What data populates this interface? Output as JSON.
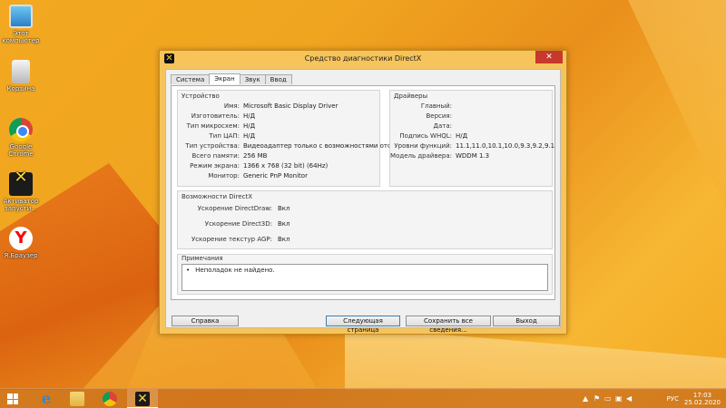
{
  "desktop": {
    "icons": [
      {
        "label": "Этот компьютер",
        "icon": "computer-icon"
      },
      {
        "label": "Корзина",
        "icon": "recycle-bin-icon"
      },
      {
        "label": "Google Chrome",
        "icon": "chrome-icon"
      },
      {
        "label": "Активатор запусти...",
        "icon": "kms-activator-icon"
      },
      {
        "label": "Я.Браузер",
        "icon": "yandex-browser-icon"
      }
    ]
  },
  "window": {
    "title": "Средство диагностики DirectX",
    "close_glyph": "✕",
    "tabs": [
      "Система",
      "Экран",
      "Звук",
      "Ввод"
    ],
    "active_tab": "Экран",
    "device": {
      "title": "Устройство",
      "rows": [
        {
          "label": "Имя:",
          "value": "Microsoft Basic Display Driver"
        },
        {
          "label": "Изготовитель:",
          "value": "Н/Д"
        },
        {
          "label": "Тип микросхем:",
          "value": "Н/Д"
        },
        {
          "label": "Тип ЦАП:",
          "value": "Н/Д"
        },
        {
          "label": "Тип устройства:",
          "value": "Видеоадаптер только с возможностями отображения"
        },
        {
          "label": "Всего памяти:",
          "value": "256 MB"
        },
        {
          "label": "Режим экрана:",
          "value": "1366 x 768 (32 bit) (64Hz)"
        },
        {
          "label": "Монитор:",
          "value": "Generic PnP Monitor"
        }
      ]
    },
    "drivers": {
      "title": "Драйверы",
      "rows": [
        {
          "label": "Главный:",
          "value": ""
        },
        {
          "label": "Версия:",
          "value": ""
        },
        {
          "label": "Дата:",
          "value": ""
        },
        {
          "label": "Подпись WHQL:",
          "value": "Н/Д"
        },
        {
          "label": "Уровни функций:",
          "value": "11.1,11.0,10.1,10.0,9.3,9.2,9.1"
        },
        {
          "label": "Модель драйвера:",
          "value": "WDDM 1.3"
        }
      ]
    },
    "directx_features": {
      "title": "Возможности DirectX",
      "rows": [
        {
          "label": "Ускорение DirectDraw:",
          "value": "Вкл"
        },
        {
          "label": "Ускорение Direct3D:",
          "value": "Вкл"
        },
        {
          "label": "Ускорение текстур AGP:",
          "value": "Вкл"
        }
      ]
    },
    "notes": {
      "title": "Примечания",
      "items": [
        "Неполадок не найдено."
      ]
    },
    "buttons": {
      "help": "Справка",
      "next_page": "Следующая страница",
      "save_all": "Сохранить все сведения...",
      "exit": "Выход"
    }
  },
  "taskbar": {
    "language": "РУС",
    "time": "17:03",
    "date": "25.02.2020"
  }
}
